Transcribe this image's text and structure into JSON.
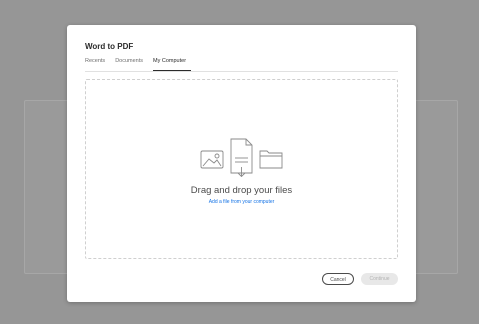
{
  "modal": {
    "title": "Word to PDF",
    "tabs": [
      {
        "label": "Recents"
      },
      {
        "label": "Documents"
      },
      {
        "label": "My Computer"
      }
    ],
    "active_tab": "My Computer",
    "dropzone": {
      "heading": "Drag and drop your files",
      "link": "Add a file from your computer"
    },
    "buttons": {
      "cancel": "Cancel",
      "continue": "Continue"
    }
  },
  "colors": {
    "accent_link": "#1473e6",
    "backdrop": "#9e9e9e"
  },
  "icons": [
    "image-icon",
    "document-icon",
    "folder-icon"
  ]
}
